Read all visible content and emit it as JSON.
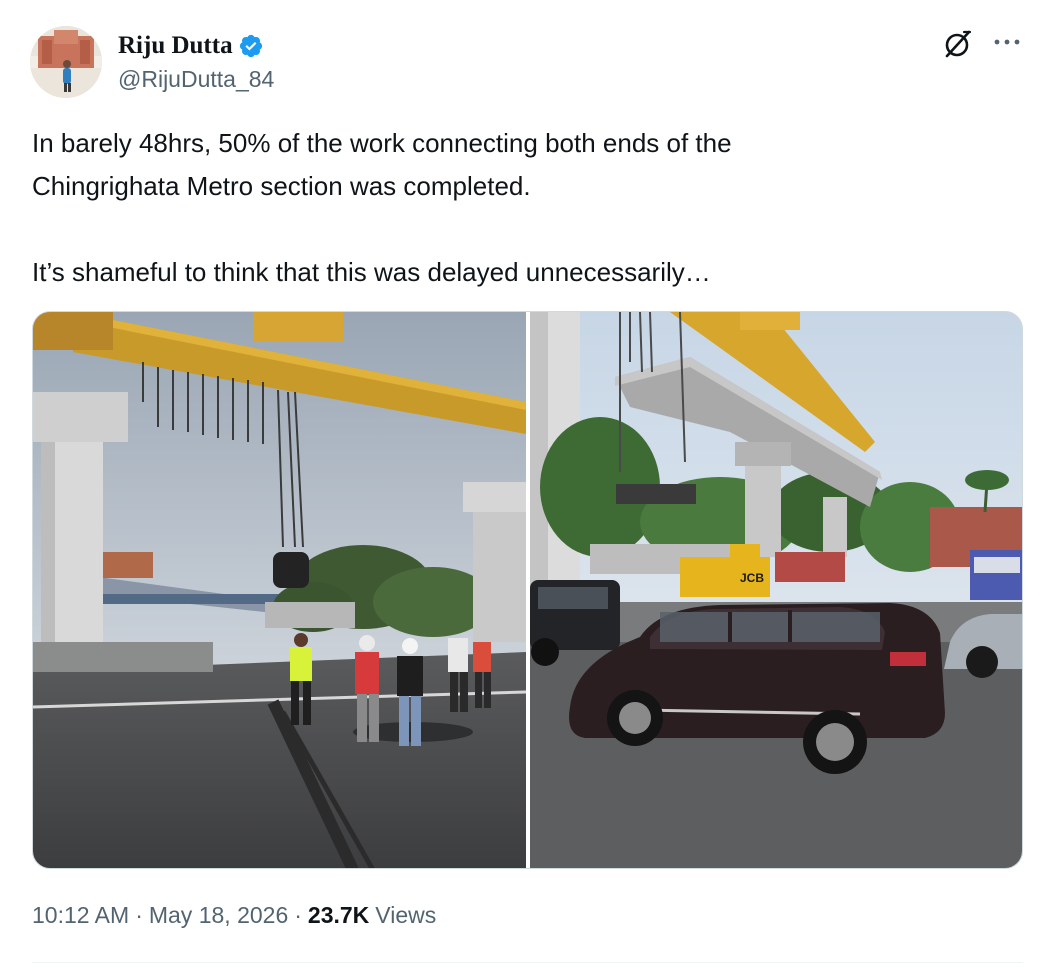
{
  "author": {
    "display_name": "Riju Dutta",
    "handle": "@RijuDutta_84",
    "verified": true,
    "verified_color": "#1d9bf0"
  },
  "tweet": {
    "paragraph1_line1": "In barely 48hrs, 50% of the work connecting both ends of the",
    "paragraph1_line2": "Chingrighata Metro section was completed.",
    "paragraph2": "It’s shameful to think that this was delayed unnecessarily…"
  },
  "meta": {
    "time": "10:12 AM",
    "separator": "·",
    "date": "May 18, 2026",
    "views_count": "23.7K",
    "views_label": "Views"
  },
  "media": {
    "left_photo_sign_text": "",
    "right_photo_vehicle_text": "JCB"
  },
  "icons": {
    "grok": "grok-icon",
    "more": "more-icon",
    "verified": "verified-badge-icon"
  }
}
